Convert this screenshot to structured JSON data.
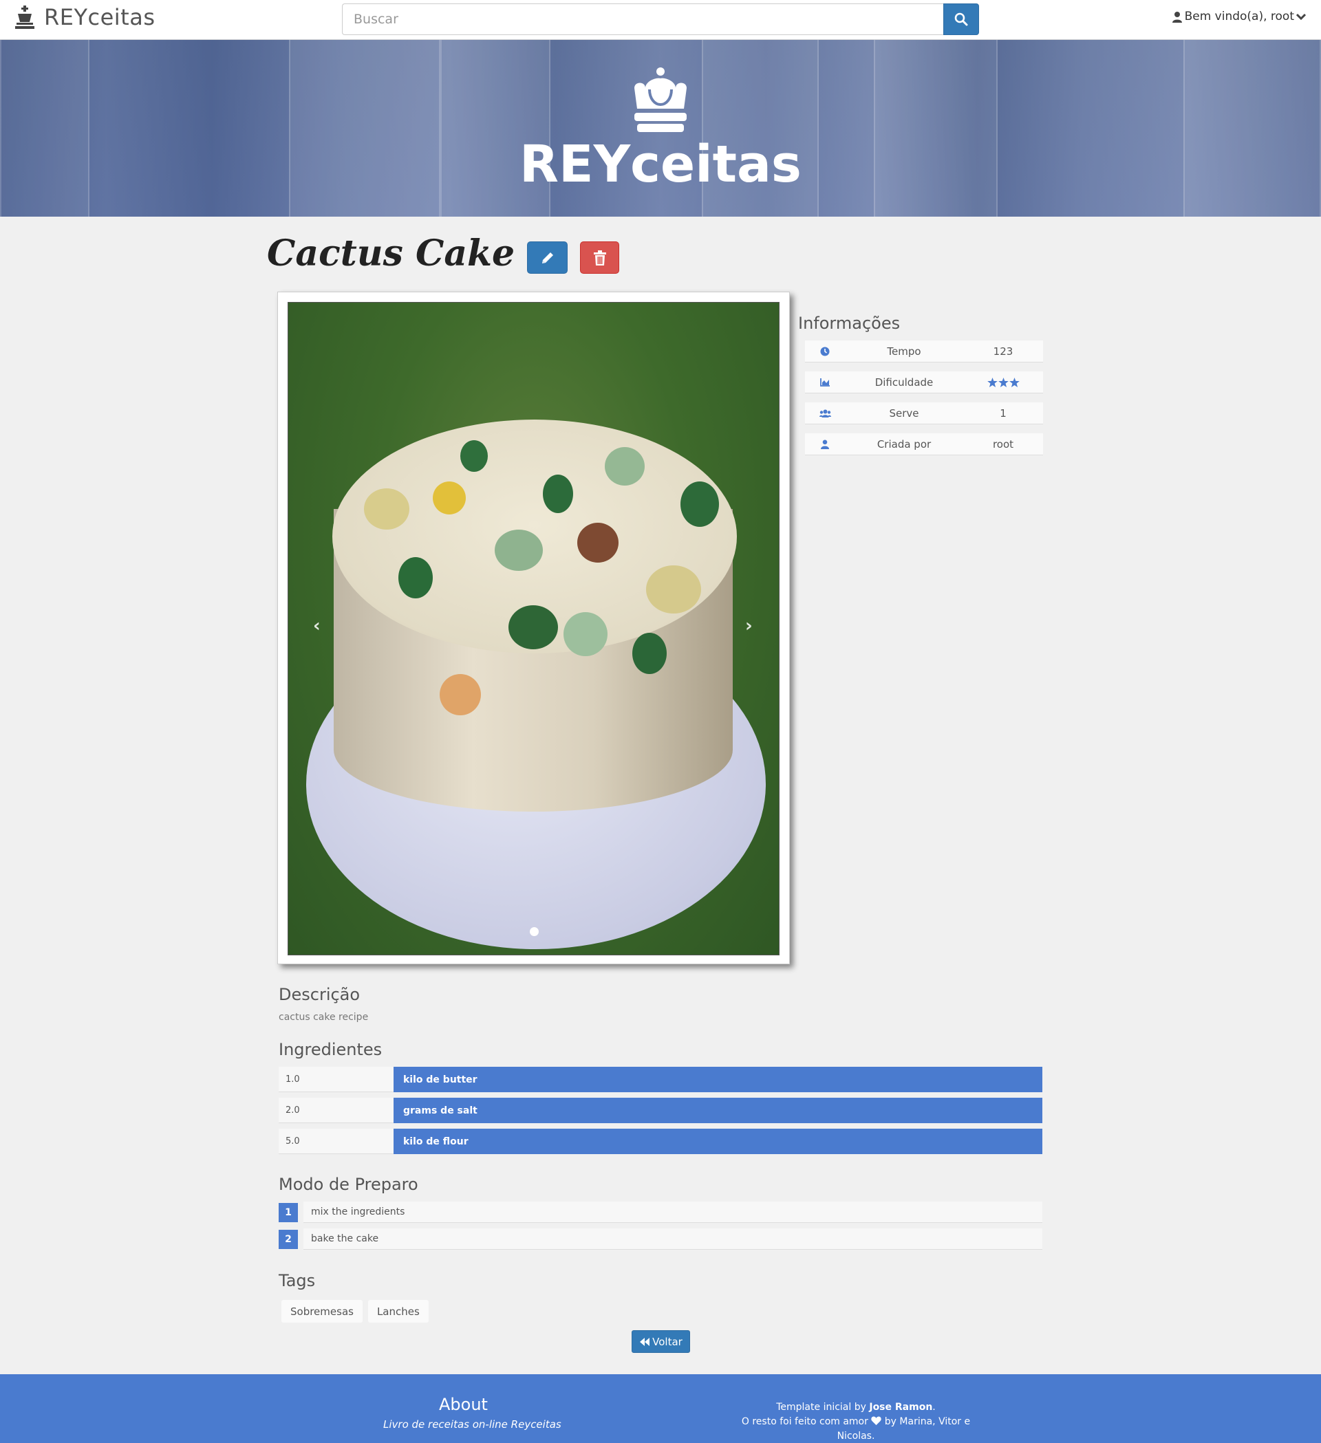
{
  "navbar": {
    "brand": "REYceitas",
    "search_placeholder": "Buscar",
    "user_greeting": "Bem vindo(a), root"
  },
  "hero": {
    "title": "REYceitas"
  },
  "recipe": {
    "title": "Cactus Cake",
    "image_alt": "Cactus cake photo"
  },
  "info": {
    "title": "Informações",
    "rows": [
      {
        "icon": "clock-icon",
        "label": "Tempo",
        "value": "123"
      },
      {
        "icon": "chart-icon",
        "label": "Dificuldade",
        "stars": 3
      },
      {
        "icon": "users-icon",
        "label": "Serve",
        "value": "1"
      },
      {
        "icon": "user-icon",
        "label": "Criada por",
        "value": "root"
      }
    ]
  },
  "description": {
    "title": "Descrição",
    "text": "cactus cake recipe"
  },
  "ingredients": {
    "title": "Ingredientes",
    "items": [
      {
        "qty": "1.0",
        "name": "kilo de butter"
      },
      {
        "qty": "2.0",
        "name": "grams de salt"
      },
      {
        "qty": "5.0",
        "name": "kilo de flour"
      }
    ]
  },
  "steps": {
    "title": "Modo de Preparo",
    "items": [
      {
        "num": "1",
        "text": "mix the ingredients"
      },
      {
        "num": "2",
        "text": "bake the cake"
      }
    ]
  },
  "tags": {
    "title": "Tags",
    "items": [
      "Sobremesas",
      "Lanches"
    ]
  },
  "back_label": "Voltar",
  "footer": {
    "about_title": "About",
    "about_subtitle": "Livro de receitas on-line Reyceitas",
    "credit_prefix": "Template inicial by ",
    "credit_author": "Jose Ramon",
    "credit_suffix": ".",
    "credit_line2_prefix": "O resto foi feito com amor ",
    "credit_line2_suffix": " by Marina, Vitor e Nicolas."
  },
  "colors": {
    "primary": "#337ab7",
    "accent_blue": "#4a7bcf",
    "danger": "#d9534f",
    "page_bg": "#f0f0f0"
  }
}
